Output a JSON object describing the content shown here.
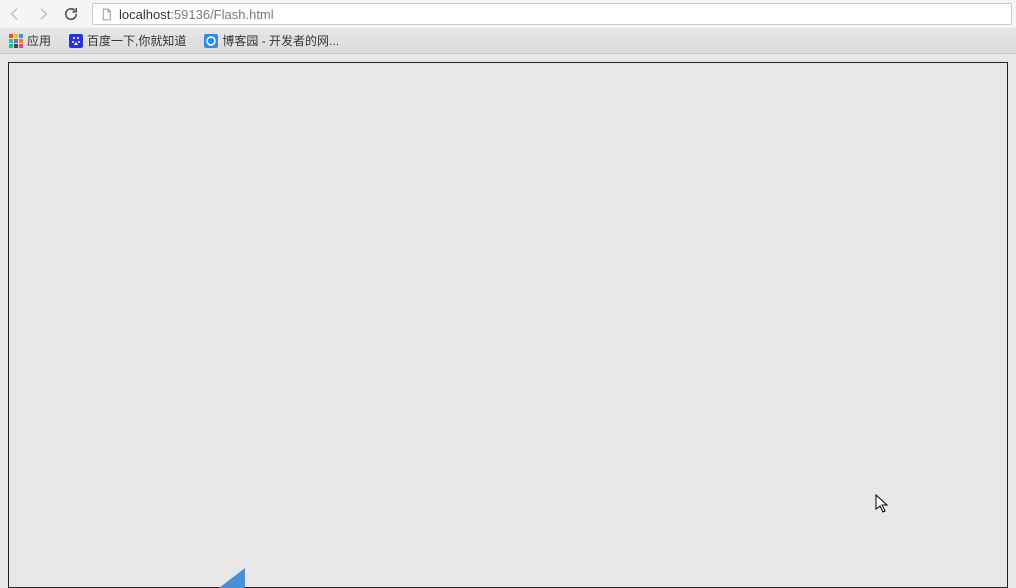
{
  "address": {
    "host": "localhost",
    "port_path": ":59136/Flash.html"
  },
  "bookmarks": {
    "apps_label": "应用",
    "items": [
      {
        "label": "百度一下,你就知道"
      },
      {
        "label": "博客园 - 开发者的网..."
      }
    ]
  }
}
